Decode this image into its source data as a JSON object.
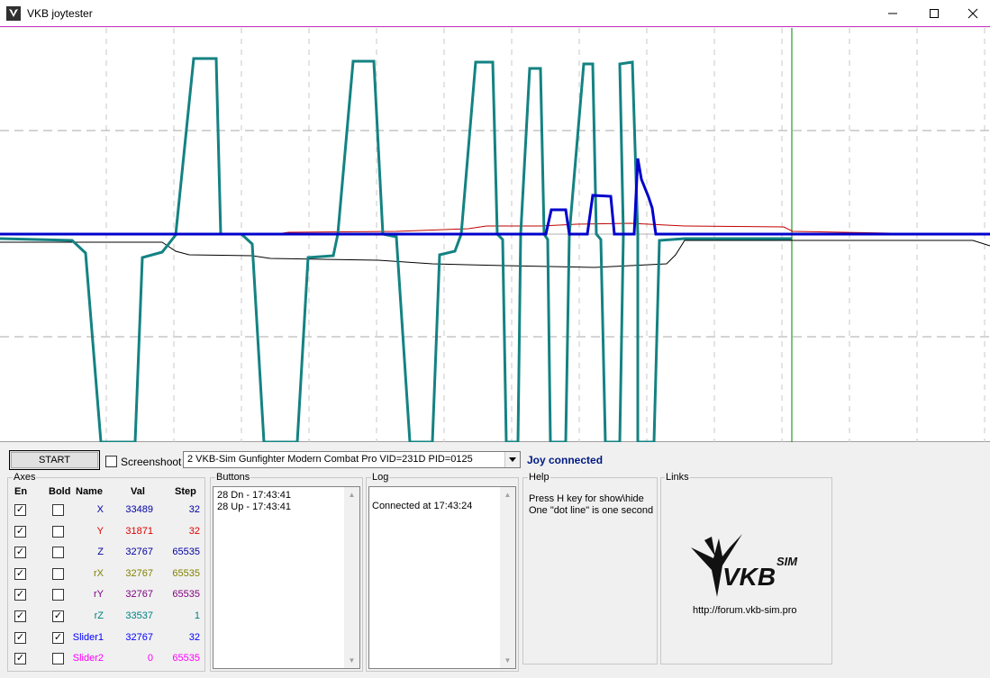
{
  "window": {
    "title": "VKB joytester"
  },
  "toolbar": {
    "start_label": "START",
    "screenshoot_label": "Screenshoot",
    "device": "2  VKB-Sim Gunfighter Modern Combat Pro  VID=231D PID=0125",
    "status": "Joy connected"
  },
  "axes": {
    "title": "Axes",
    "headers": {
      "en": "En",
      "bold": "Bold",
      "name": "Name",
      "val": "Val",
      "step": "Step"
    },
    "rows": [
      {
        "name": "X",
        "val": "33489",
        "step": "32",
        "en": true,
        "bold": false,
        "color": "#0000a0"
      },
      {
        "name": "Y",
        "val": "31871",
        "step": "32",
        "en": true,
        "bold": false,
        "color": "#e00000"
      },
      {
        "name": "Z",
        "val": "32767",
        "step": "65535",
        "en": true,
        "bold": false,
        "color": "#0000a0"
      },
      {
        "name": "rX",
        "val": "32767",
        "step": "65535",
        "en": true,
        "bold": false,
        "color": "#808000"
      },
      {
        "name": "rY",
        "val": "32767",
        "step": "65535",
        "en": true,
        "bold": false,
        "color": "#800080"
      },
      {
        "name": "rZ",
        "val": "33537",
        "step": "1",
        "en": true,
        "bold": true,
        "color": "#008080"
      },
      {
        "name": "Slider1",
        "val": "32767",
        "step": "32",
        "en": true,
        "bold": true,
        "color": "#0000ff"
      },
      {
        "name": "Slider2",
        "val": "0",
        "step": "65535",
        "en": true,
        "bold": false,
        "color": "#ff00ff"
      }
    ]
  },
  "buttons_log": {
    "title": "Buttons",
    "entries": [
      "28 Dn - 17:43:41",
      "28 Up - 17:43:41"
    ]
  },
  "log": {
    "title": "Log",
    "entries": [
      "Connected at 17:43:24"
    ]
  },
  "help": {
    "title": "Help",
    "lines": [
      "Press H key for show\\hide",
      "One \"dot line\" is one second"
    ]
  },
  "links": {
    "title": "Links",
    "url": "http://forum.vkb-sim.pro",
    "logo_text": "VKB",
    "logo_sup": "SIM"
  },
  "colors": {
    "teal": "#148282",
    "blue": "#0000cc",
    "red": "#c00000",
    "black": "#000000",
    "cursor": "#008000"
  }
}
